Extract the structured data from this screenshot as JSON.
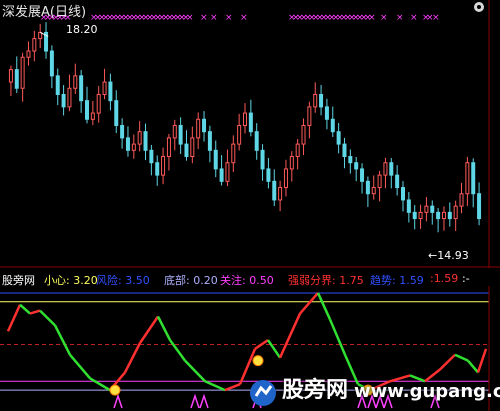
{
  "main_chart": {
    "title": "深发展A(日线)",
    "high_label": "18.20",
    "low_label": "←14.93",
    "colors": {
      "up": "#ff5a5a",
      "down": "#5fd7e6",
      "signal_marks": "#ff40ff"
    },
    "price_range": [
      14.5,
      18.4
    ]
  },
  "indicator_bar": {
    "name": "股旁网",
    "items": [
      {
        "label": "小心:",
        "value": "3.20",
        "color": "#ffff60"
      },
      {
        "label": "风险:",
        "value": "3.50",
        "color": "#3050ff"
      },
      {
        "label": "底部:",
        "value": "0.20",
        "color": "#b0b0ff"
      },
      {
        "label": "关注:",
        "value": "0.50",
        "color": "#ff40ff"
      },
      {
        "label": "强弱分界:",
        "value": "1.75",
        "color": "#ff3030"
      },
      {
        "label": "趋势:",
        "value": "1.59",
        "color": "#3050ff"
      },
      {
        "label": ":",
        "value": "1.59",
        "color": "#ff3030"
      },
      {
        "label": ":",
        "value": "-",
        "color": "#ffffff"
      }
    ]
  },
  "watermark": {
    "cn": "股旁网",
    "en": "www.gupang.com"
  },
  "chart_data": {
    "type": "candlestick",
    "title": "深发展A(日线)",
    "ylim": [
      14.5,
      18.4
    ],
    "annotations": [
      "18.20",
      "14.93"
    ],
    "price_series_approx": [
      17.6,
      17.3,
      17.8,
      17.9,
      18.1,
      18.2,
      17.9,
      17.5,
      17.2,
      17.0,
      17.3,
      17.5,
      17.1,
      16.8,
      16.9,
      17.2,
      17.4,
      17.1,
      16.7,
      16.5,
      16.3,
      16.4,
      16.6,
      16.3,
      16.1,
      15.9,
      16.2,
      16.5,
      16.7,
      16.4,
      16.2,
      16.5,
      16.8,
      16.6,
      16.3,
      16.0,
      15.8,
      16.1,
      16.4,
      16.7,
      16.9,
      16.6,
      16.3,
      16.0,
      15.8,
      15.5,
      15.7,
      16.0,
      16.2,
      16.4,
      16.7,
      17.0,
      17.2,
      17.0,
      16.8,
      16.6,
      16.4,
      16.2,
      16.1,
      16.0,
      15.8,
      15.6,
      15.7,
      15.9,
      16.1,
      15.9,
      15.7,
      15.5,
      15.3,
      15.2,
      15.3,
      15.4,
      15.3,
      15.2,
      15.3,
      15.2,
      15.4,
      15.6,
      16.1,
      15.6,
      15.2
    ],
    "indicator_levels": {
      "小心": 3.2,
      "风险": 3.5,
      "底部": 0.2,
      "关注": 0.5,
      "强弱分界": 1.75
    }
  }
}
